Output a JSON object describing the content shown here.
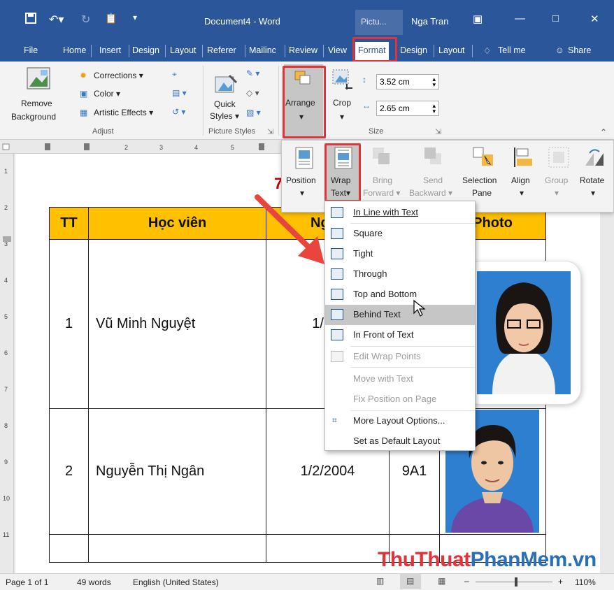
{
  "titlebar": {
    "doc_title": "Document4 - Word",
    "context_tab": "Pictu...",
    "user_name": "Nga Tran"
  },
  "tabs": [
    "File",
    "Home",
    "Insert",
    "Design",
    "Layout",
    "Referer",
    "Mailinc",
    "Review",
    "View",
    "Format",
    "Design",
    "Layout",
    "Tell me",
    "Share"
  ],
  "ribbon": {
    "remove_bg": "Remove",
    "remove_bg2": "Background",
    "corrections": "Corrections",
    "color": "Color",
    "artistic": "Artistic Effects",
    "adjust": "Adjust",
    "quick_styles": "Quick",
    "quick_styles2": "Styles",
    "picture_styles": "Picture Styles",
    "arrange": "Arrange",
    "crop": "Crop",
    "height": "3.52 cm",
    "width": "2.65 cm",
    "size": "Size"
  },
  "arrange_popup": {
    "position": "Position",
    "wrap_text": "Wrap",
    "wrap_text2": "Text",
    "bring_forward": "Bring",
    "bring_forward2": "Forward",
    "send_backward": "Send",
    "send_backward2": "Backward",
    "selection_pane": "Selection",
    "selection_pane2": "Pane",
    "align": "Align",
    "group": "Group",
    "rotate": "Rotate"
  },
  "wrap_menu": [
    {
      "label": "In Line with Text",
      "state": "normal"
    },
    {
      "label": "Square",
      "state": "normal"
    },
    {
      "label": "Tight",
      "state": "normal"
    },
    {
      "label": "Through",
      "state": "normal"
    },
    {
      "label": "Top and Bottom",
      "state": "normal"
    },
    {
      "label": "Behind Text",
      "state": "highlighted"
    },
    {
      "label": "In Front of Text",
      "state": "normal"
    },
    {
      "label": "Edit Wrap Points",
      "state": "disabled"
    },
    {
      "label": "Move with Text",
      "state": "disabled"
    },
    {
      "label": "Fix Position on Page",
      "state": "disabled"
    },
    {
      "label": "More Layout Options...",
      "state": "normal"
    },
    {
      "label": "Set as Default Layout",
      "state": "normal"
    }
  ],
  "table": {
    "headers": [
      "TT",
      "Học viên",
      "Ngày",
      "",
      "Photo"
    ],
    "rows": [
      {
        "tt": "1",
        "name": "Vũ Minh Nguyệt",
        "date": "1/1/1",
        "class": ""
      },
      {
        "tt": "2",
        "name": "Nguyễn Thị Ngân",
        "date": "1/2/2004",
        "class": "9A1"
      }
    ]
  },
  "doc_fragment": "7",
  "statusbar": {
    "page": "Page 1 of 1",
    "words": "49 words",
    "language": "English (United States)",
    "zoom": "110%"
  },
  "watermark": {
    "part1": "ThuThuat",
    "part2": "PhanMem",
    "part3": ".vn"
  },
  "colors": {
    "word_blue": "#2b579a",
    "highlight_red": "#e0343c",
    "table_header": "#ffc000"
  }
}
